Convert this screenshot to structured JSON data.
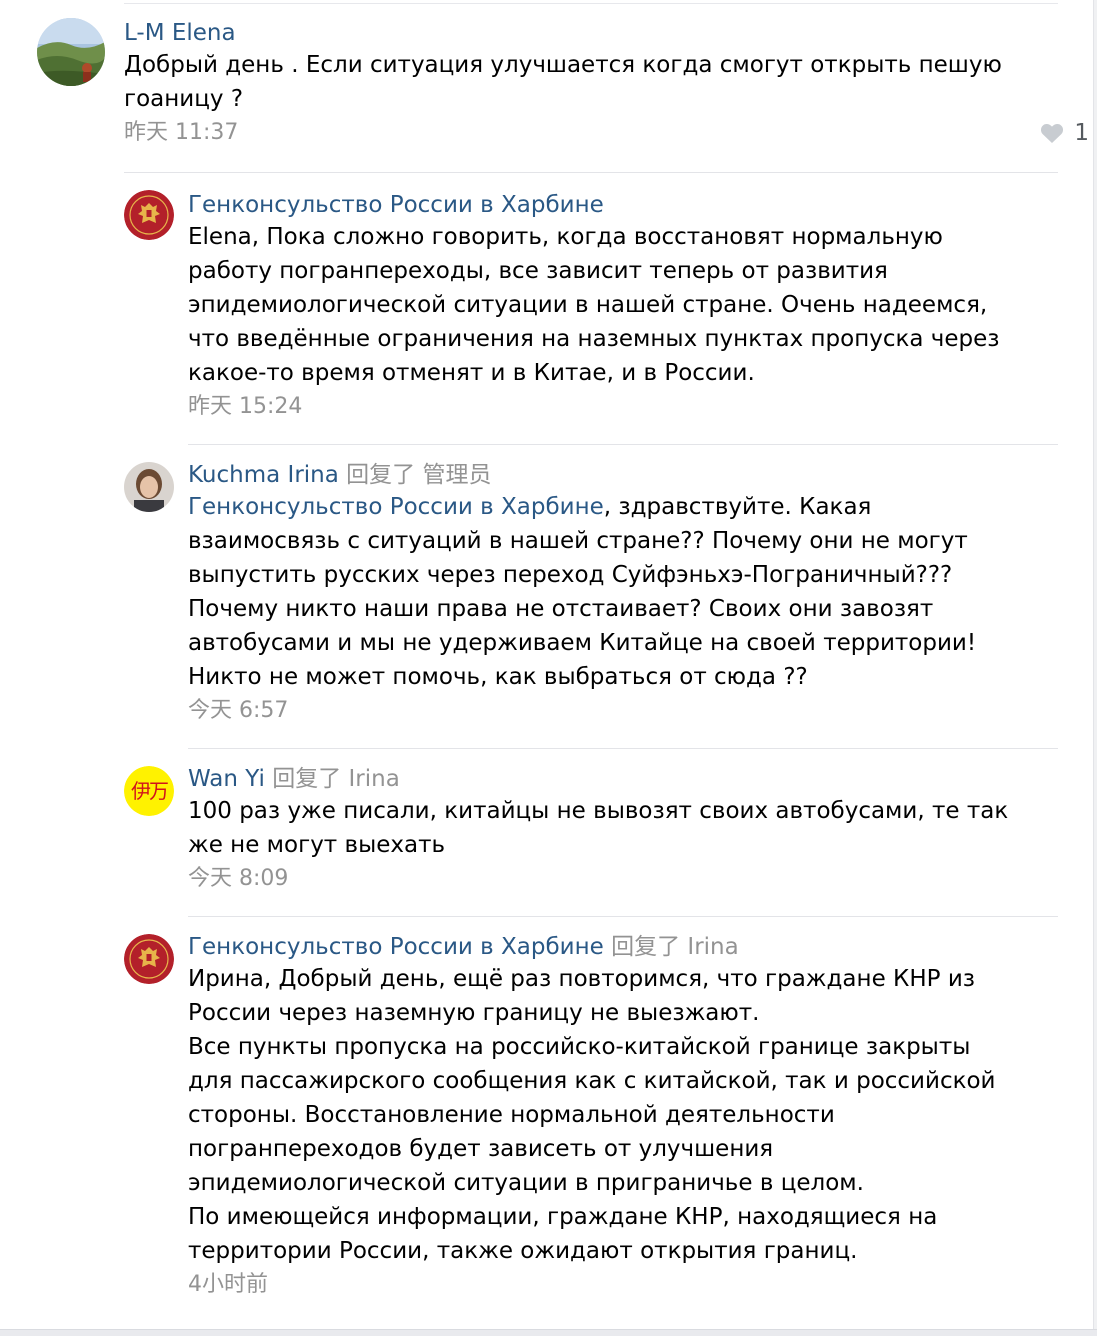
{
  "comments": [
    {
      "author": "L-M Elena",
      "reply_word": "",
      "reply_target": "",
      "mention": "",
      "lines": [
        "Добрый день . Если ситуация улучшается когда смогут открыть пешую",
        "гоаницу ?"
      ],
      "time": "昨天 11:37",
      "likes": "1",
      "avatar": "landscape-photo-avatar"
    },
    {
      "author": "Генконсульство России в Харбине",
      "reply_word": "",
      "reply_target": "",
      "mention": "",
      "lines": [
        "Elena, Пока сложно говорить, когда восстановят нормальную",
        "работу погранпереходы, все зависит теперь от развития",
        "эпидемиологической ситуации в нашей стране. Очень надеемся,",
        "что введённые ограничения на наземных пунктах пропуска через",
        "какое-то время отменят и в Китае, и в России."
      ],
      "time": "昨天 15:24",
      "avatar": "russian-emblem-avatar"
    },
    {
      "author": "Kuchma Irina",
      "reply_word": "回复了",
      "reply_target": "管理员",
      "mention": "Генконсульство России в Харбине",
      "mention_rest": ", здравствуйте. Какая",
      "lines": [
        "взаимосвязь с ситуаций в нашей стране?? Почему они не могут",
        "выпустить русских через переход Суйфэньхэ-Пограничный???",
        "Почему никто наши права не отстаивает? Своих они завозят",
        "автобусами и мы не удерживаем Китайце на своей территории!",
        "Никто не может помочь, как выбраться от сюда ??"
      ],
      "time": "今天 6:57",
      "avatar": "woman-portrait-avatar"
    },
    {
      "author": "Wan Yi",
      "reply_word": "回复了",
      "reply_target": "Irina",
      "mention": "",
      "lines": [
        "100 раз уже писали, китайцы не вывозят своих автобусами, те так",
        "же не могут выехать"
      ],
      "time": "今天 8:09",
      "avatar": "chinese-characters-avatar",
      "avatar_text": "伊万"
    },
    {
      "author": "Генконсульство России в Харбине",
      "reply_word": "回复了",
      "reply_target": "Irina",
      "mention": "",
      "lines": [
        "Ирина, Добрый день, ещё раз повторимся, что граждане КНР из",
        "России через наземную границу не выезжают.",
        "Все пункты пропуска на российско-китайской границе закрыты",
        "для пассажирского сообщения как с китайской, так и российской",
        "стороны. Восстановление нормальной деятельности",
        "погранпереходов будет зависеть от улучшения",
        "эпидемиологической ситуации в приграничье в целом.",
        "По имеющейся информации, граждане КНР, находящиеся на",
        "территории России, также ожидают открытия границ."
      ],
      "time": "4小时前",
      "avatar": "russian-emblem-avatar"
    }
  ],
  "colors": {
    "author": "#2a5885",
    "meta": "#939393",
    "separator": "#e3e4e8",
    "emblem_red": "#b3202a",
    "avatar_yellow": "#fff200"
  }
}
